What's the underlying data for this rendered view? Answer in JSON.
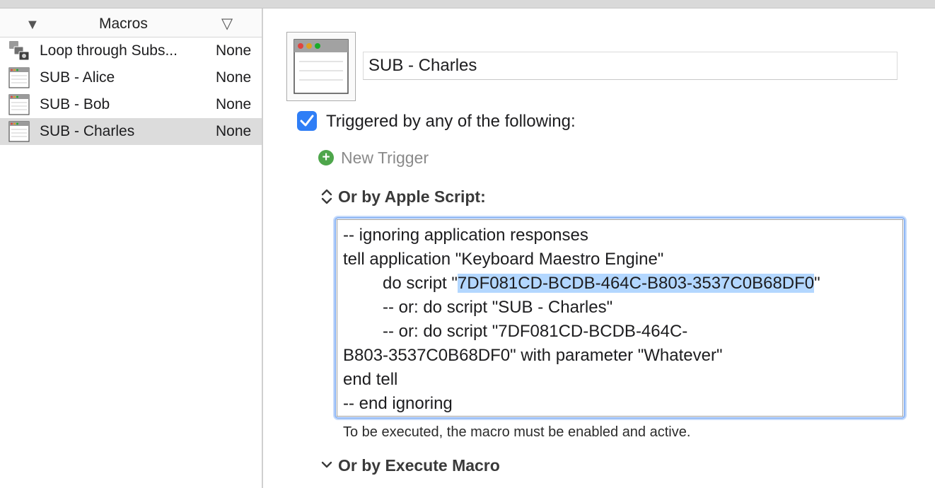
{
  "sidebar": {
    "header": {
      "title": "Macros",
      "left_icon": "triangle-down-icon",
      "right_icon": "triangle-down-outline-icon"
    },
    "macros": [
      {
        "name": "Loop through Subs...",
        "status": "None",
        "icon": "macro-group-icon",
        "selected": false
      },
      {
        "name": "SUB - Alice",
        "status": "None",
        "icon": "window-icon",
        "selected": false
      },
      {
        "name": "SUB - Bob",
        "status": "None",
        "icon": "window-icon",
        "selected": false
      },
      {
        "name": "SUB - Charles",
        "status": "None",
        "icon": "window-icon",
        "selected": true
      }
    ]
  },
  "editor": {
    "macro_name": "SUB - Charles",
    "triggered_label": "Triggered by any of the following:",
    "triggered_checked": true,
    "new_trigger_label": "New Trigger",
    "apple_script_section": "Or by Apple Script:",
    "script": {
      "line1": "-- ignoring application responses",
      "line2": "tell application \"Keyboard Maestro Engine\"",
      "line3_pre": "do script \"",
      "line3_uuid": "7DF081CD-BCDB-464C-B803-3537C0B68DF0",
      "line3_post": "\"",
      "line4": "-- or: do script \"SUB - Charles\"",
      "line5": "-- or: do script \"7DF081CD-BCDB-464C-",
      "line6": "B803-3537C0B68DF0\" with parameter \"Whatever\"",
      "line7": "end tell",
      "line8": "-- end ignoring"
    },
    "hint": "To be executed, the macro must be enabled and active.",
    "execute_macro_section": "Or by Execute Macro"
  },
  "colors": {
    "accent": "#2f7ef6",
    "selection_highlight": "#b3d7ff",
    "selected_row": "#dcdcdc",
    "add_green": "#4ea64b"
  }
}
